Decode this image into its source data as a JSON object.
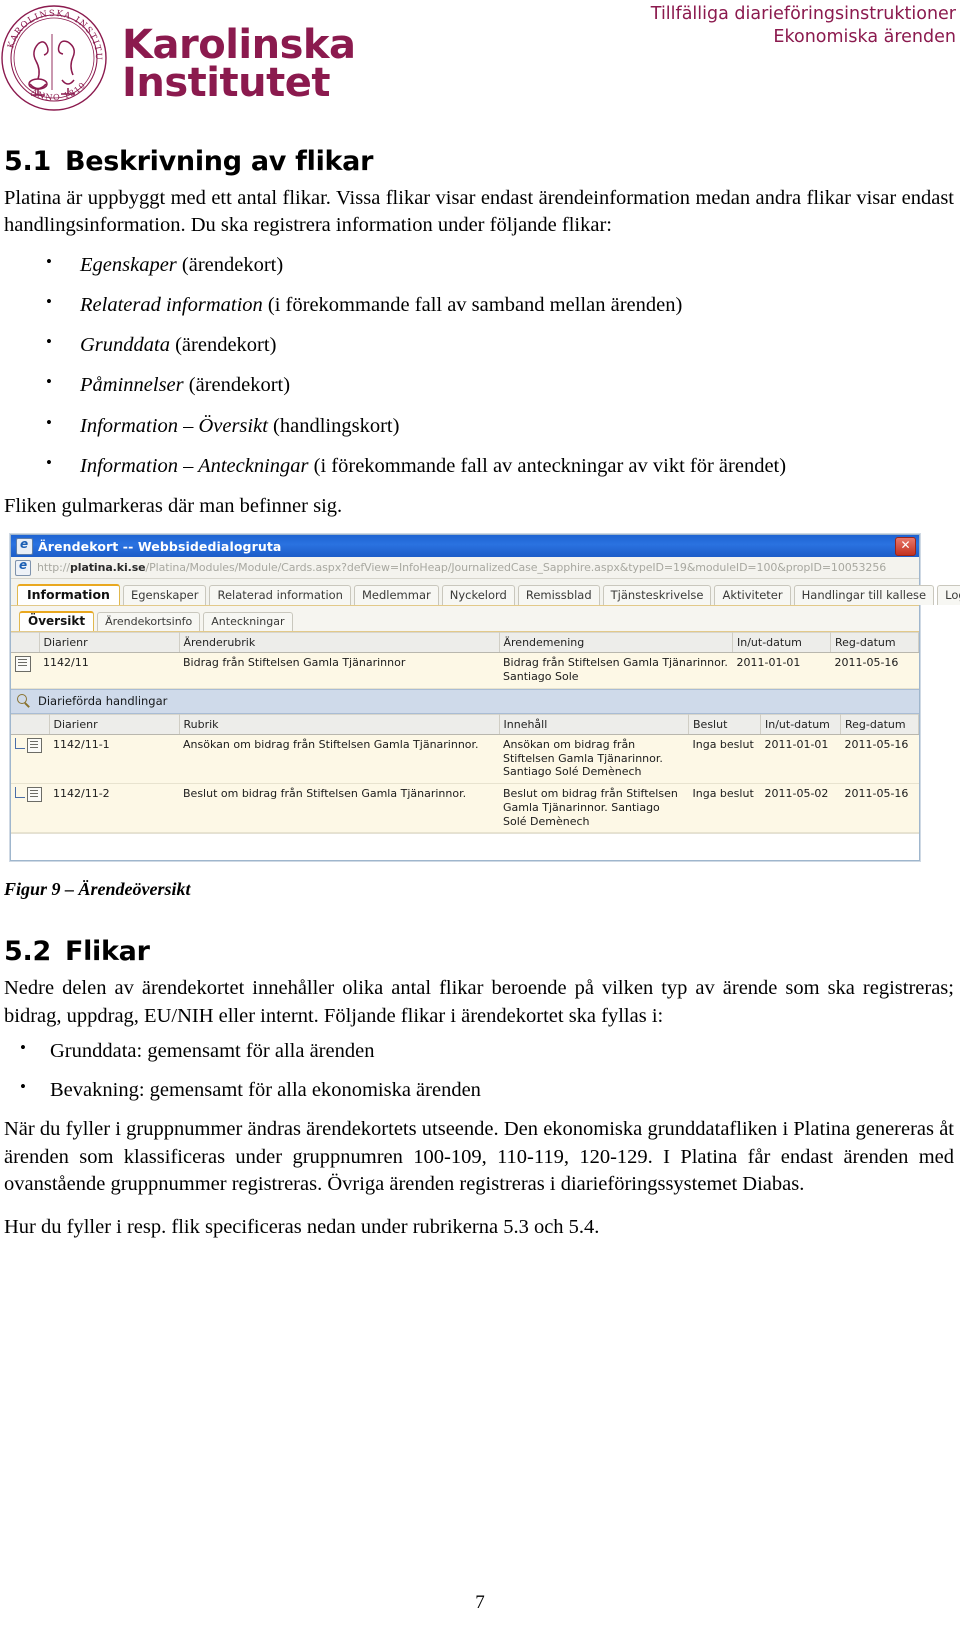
{
  "header": {
    "logo_line1": "Karolinska",
    "logo_line2": "Institutet",
    "seal_top": "KAROLINSKA INSTITUTET",
    "seal_bottom": "ANNO 1810",
    "doc_title_line1": "Tillfälliga diarieföringsinstruktioner",
    "doc_title_line2": "Ekonomiska ärenden",
    "brand_color": "#8b1a4e"
  },
  "section_51": {
    "number": "5.1",
    "title": "Beskrivning av flikar",
    "intro": "Platina är uppbyggt med ett antal flikar. Vissa flikar visar endast ärendeinformation medan andra flikar visar endast handlingsinformation. Du ska registrera information under följande flikar:",
    "bullets": [
      {
        "italic": "Egenskaper",
        "rest": " (ärendekort)"
      },
      {
        "italic": "Relaterad information",
        "rest": " (i förekommande fall av samband mellan ärenden)"
      },
      {
        "italic": "Grunddata",
        "rest": " (ärendekort)"
      },
      {
        "italic": "Påminnelser",
        "rest": " (ärendekort)"
      },
      {
        "italic": "Information – Översikt",
        "rest": " (handlingskort)"
      },
      {
        "italic": "Information – Anteckningar",
        "rest": " (i förekommande fall av anteckningar av vikt för ärendet)"
      }
    ],
    "closing": "Fliken gulmarkeras där man befinner sig."
  },
  "screenshot": {
    "window_title": "Ärendekort -- Webbsidedialogruta",
    "close_label": "✕",
    "url_bold": "platina.ki.se",
    "url_prefix": "http://",
    "url_rest": "/Platina/Modules/Module/Cards.aspx?defView=InfoHeap/JournalizedCase_Sapphire.aspx&typeID=19&moduleID=100&propID=10053256",
    "main_tabs": [
      {
        "label": "Information",
        "active": true
      },
      {
        "label": "Egenskaper",
        "active": false
      },
      {
        "label": "Relaterad information",
        "active": false
      },
      {
        "label": "Medlemmar",
        "active": false
      },
      {
        "label": "Nyckelord",
        "active": false
      },
      {
        "label": "Remissblad",
        "active": false
      },
      {
        "label": "Tjänsteskrivelse",
        "active": false
      },
      {
        "label": "Aktiviteter",
        "active": false
      },
      {
        "label": "Handlingar till kallese",
        "active": false
      },
      {
        "label": "Logg",
        "active": false
      }
    ],
    "sub_tabs": [
      {
        "label": "Översikt",
        "active": true
      },
      {
        "label": "Ärendekortsinfo",
        "active": false
      },
      {
        "label": "Anteckningar",
        "active": false
      }
    ],
    "case_table": {
      "headers": [
        "",
        "Diarienr",
        "Ärenderubrik",
        "Ärendemening",
        "In/ut-datum",
        "Reg-datum"
      ],
      "rows": [
        {
          "diarienr": "1142/11",
          "arenderubrik": "Bidrag från Stiftelsen Gamla Tjänarinnor",
          "arendemening": "Bidrag från Stiftelsen Gamla Tjänarinnor. Santiago Sole",
          "inut_datum": "2011-01-01",
          "reg_datum": "2011-05-16"
        }
      ]
    },
    "documents_section_label": "Diarieförda handlingar",
    "documents_table": {
      "headers": [
        "",
        "Diarienr",
        "Rubrik",
        "Innehåll",
        "Beslut",
        "In/ut-datum",
        "Reg-datum"
      ],
      "rows": [
        {
          "diarienr": "1142/11-1",
          "rubrik": "Ansökan om bidrag från Stiftelsen Gamla Tjänarinnor.",
          "innehall": "Ansökan om bidrag från Stiftelsen Gamla Tjänarinnor. Santiago Solé Demènech",
          "beslut": "Inga beslut",
          "inut_datum": "2011-01-01",
          "reg_datum": "2011-05-16"
        },
        {
          "diarienr": "1142/11-2",
          "rubrik": "Beslut om bidrag från Stiftelsen Gamla Tjänarinnor.",
          "innehall": "Beslut om bidrag från Stiftelsen Gamla Tjänarinnor. Santiago Solé Demènech",
          "beslut": "Inga beslut",
          "inut_datum": "2011-05-02",
          "reg_datum": "2011-05-16"
        }
      ]
    }
  },
  "figure_caption": "Figur 9 – Ärendeöversikt",
  "section_52": {
    "number": "5.2",
    "title": "Flikar",
    "intro": "Nedre delen av ärendekortet innehåller olika antal flikar beroende på vilken typ av ärende som ska registreras; bidrag, uppdrag, EU/NIH eller internt. Följande flikar i ärendekortet ska fyllas i:",
    "bullets": [
      "Grunddata: gemensamt för alla ärenden",
      "Bevakning: gemensamt för alla ekonomiska ärenden"
    ],
    "paragraph2": "När du fyller i gruppnummer ändras ärendekortets utseende. Den ekonomiska grunddatafliken i Platina genereras åt ärenden som klassificeras under gruppnumren 100-109, 110-119, 120-129. I Platina får endast ärenden med ovanstående gruppnummer registreras. Övriga ärenden registreras i diarieföringssystemet Diabas.",
    "paragraph3": "Hur du fyller i resp. flik specificeras nedan under rubrikerna 5.3 och 5.4."
  },
  "footer": {
    "page_number": "7"
  }
}
